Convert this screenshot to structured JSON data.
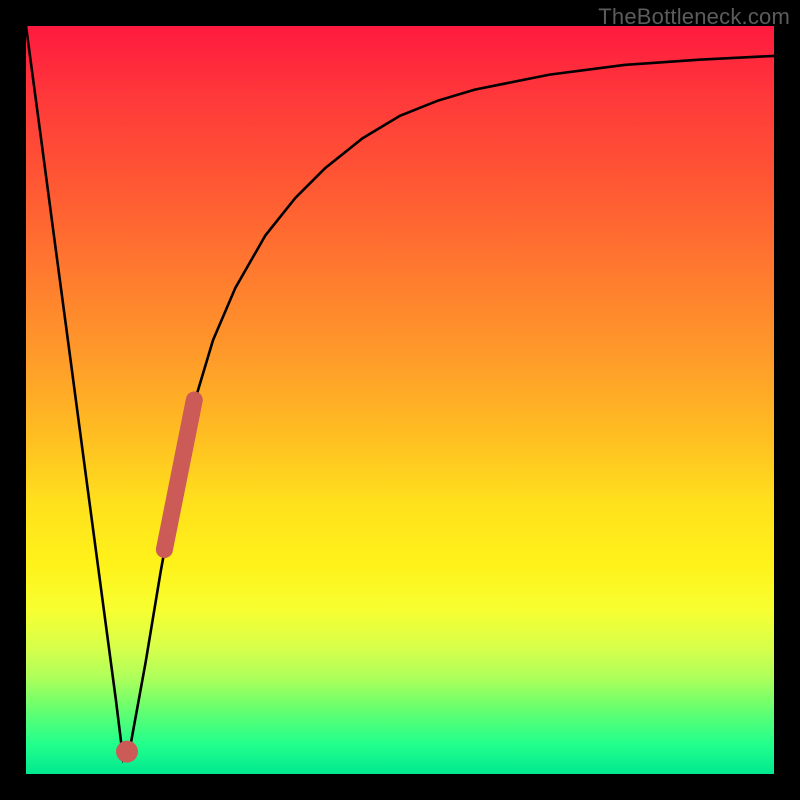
{
  "watermark": "TheBottleneck.com",
  "colors": {
    "curve": "#000000",
    "marker": "#cc5a57",
    "background_top": "#ff1a3f",
    "background_bottom": "#00e88f"
  },
  "chart_data": {
    "type": "line",
    "title": "",
    "xlabel": "",
    "ylabel": "",
    "xlim": [
      0,
      100
    ],
    "ylim": [
      0,
      100
    ],
    "grid": false,
    "legend": false,
    "series": [
      {
        "name": "bottleneck-curve",
        "x": [
          0,
          2,
          4,
          6,
          8,
          10,
          12,
          13,
          14,
          16,
          18,
          20,
          22,
          25,
          28,
          32,
          36,
          40,
          45,
          50,
          55,
          60,
          70,
          80,
          90,
          100
        ],
        "y": [
          100,
          85,
          70,
          55,
          40,
          25,
          10,
          2,
          4,
          15,
          27,
          38,
          48,
          58,
          65,
          72,
          77,
          81,
          85,
          88,
          90,
          91.5,
          93.5,
          94.8,
          95.5,
          96
        ]
      }
    ],
    "markers": [
      {
        "name": "near-minimum-dot",
        "x": 13.5,
        "y": 3
      },
      {
        "name": "highlight-segment",
        "x_from": 18.5,
        "y_from": 30,
        "x_to": 22.5,
        "y_to": 50
      }
    ]
  }
}
